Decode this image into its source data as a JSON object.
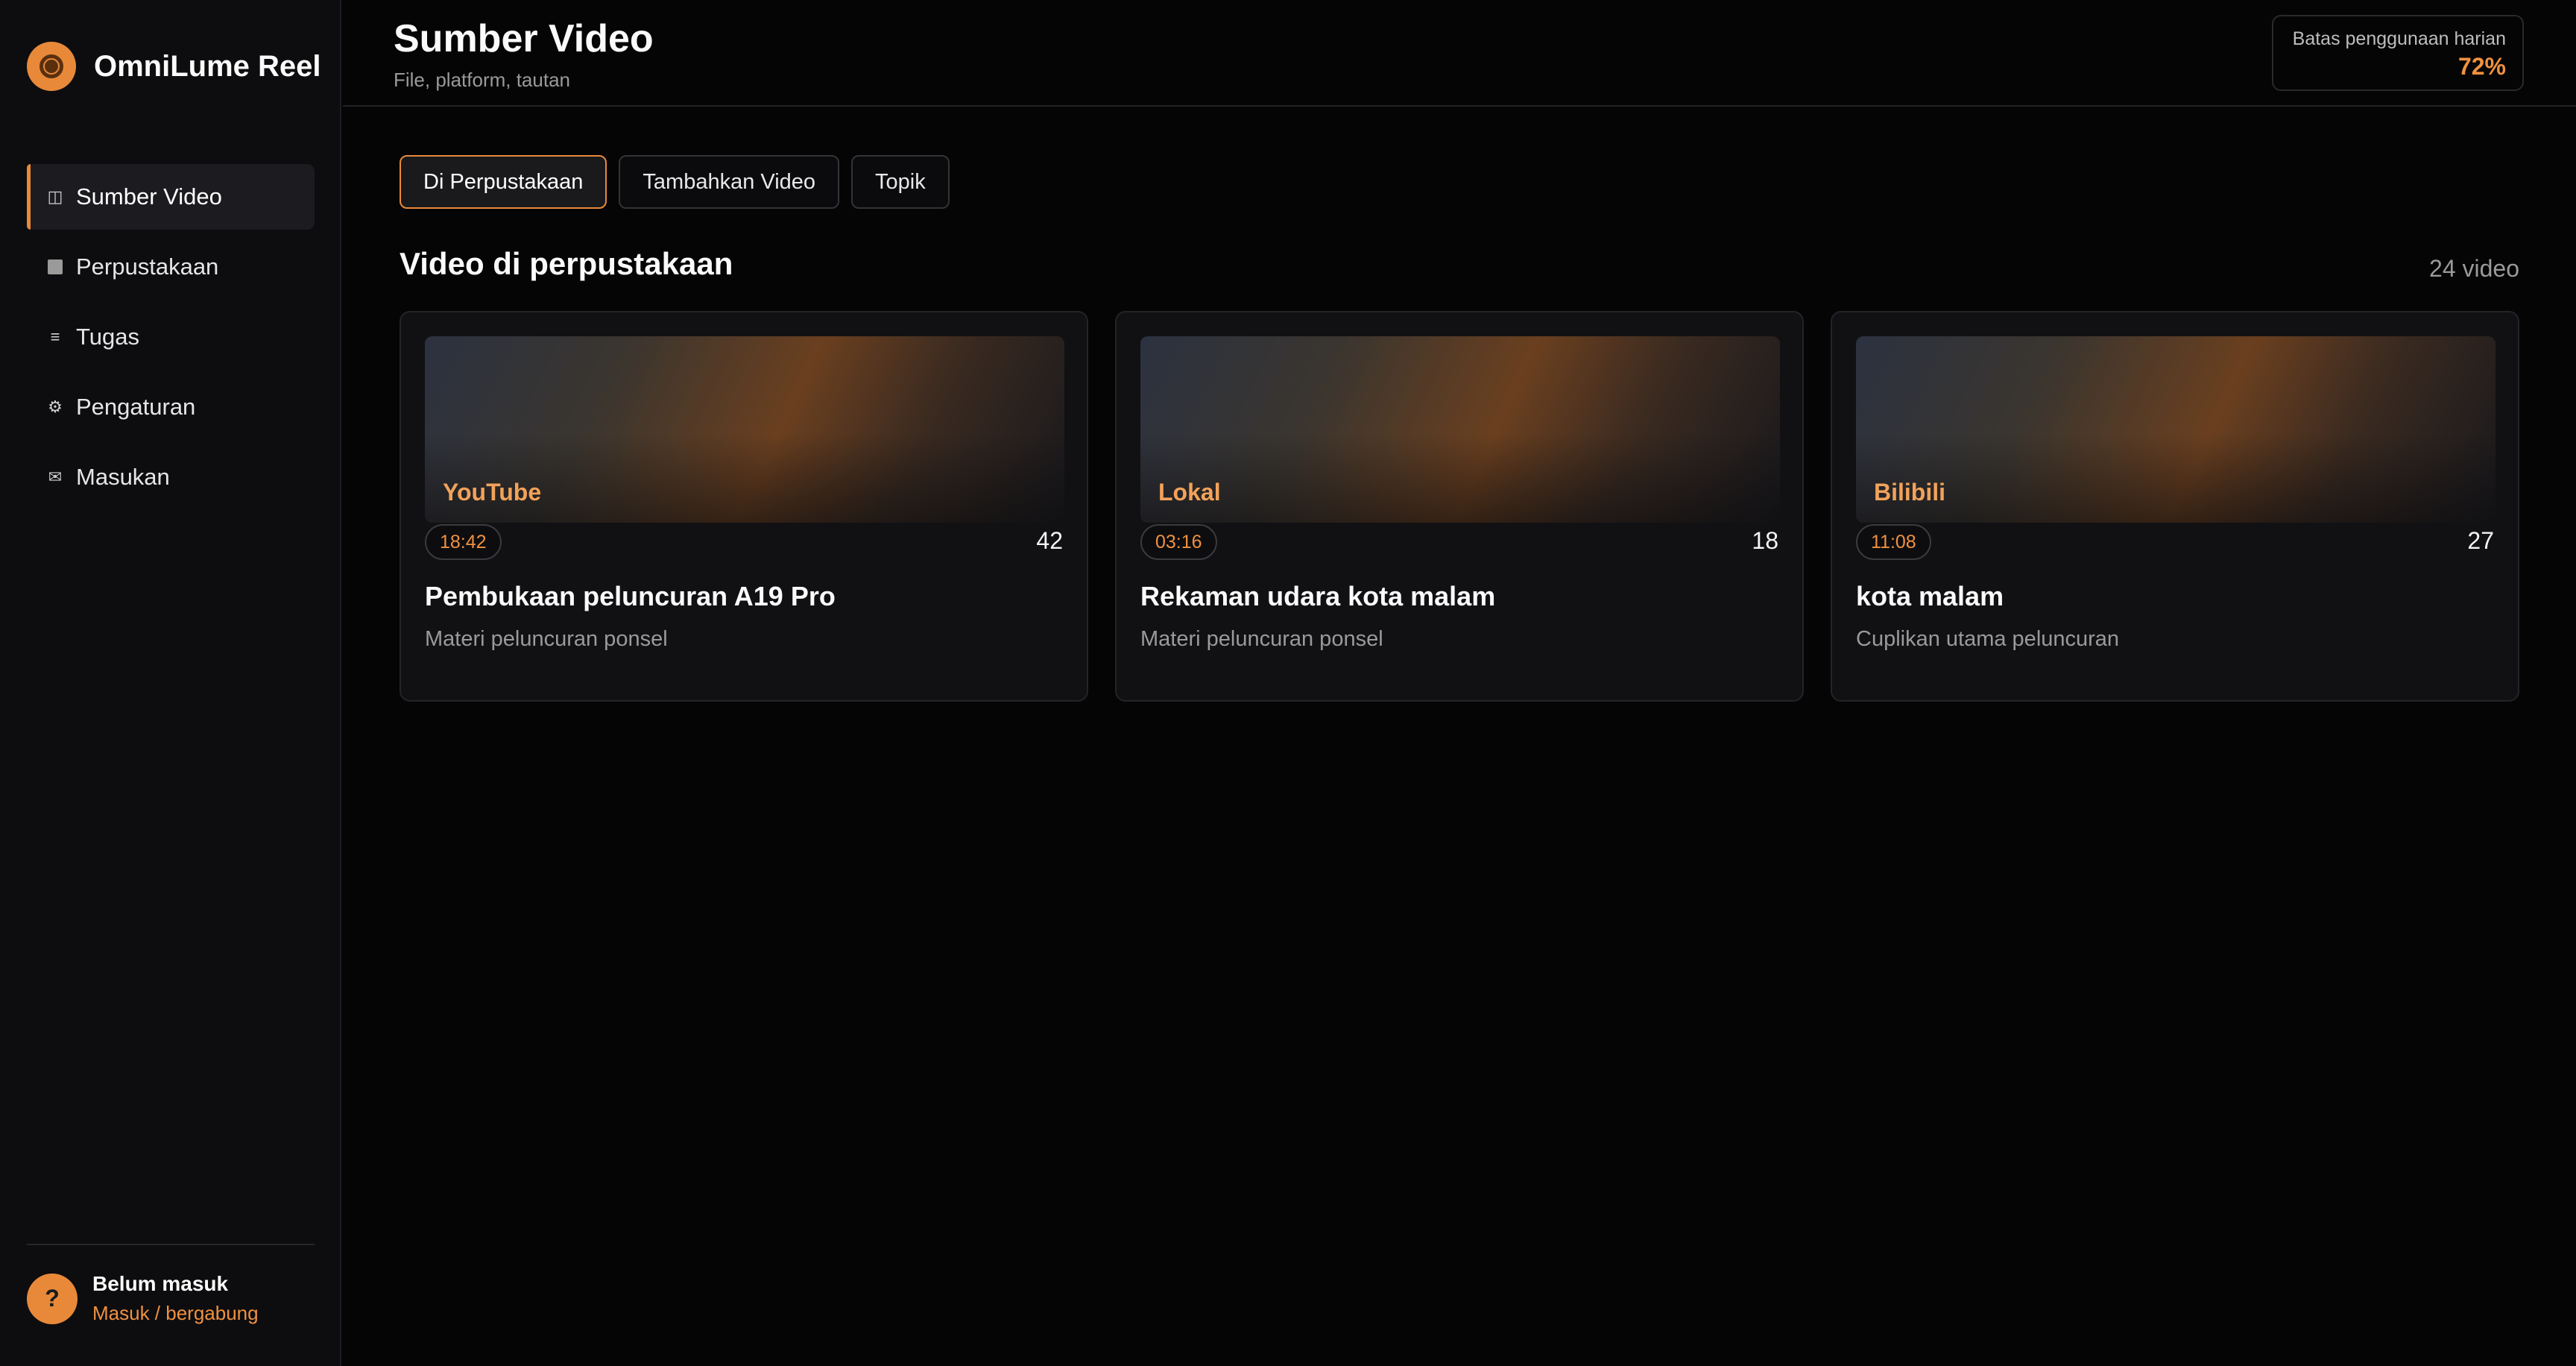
{
  "brand": {
    "name": "OmniLume Reel",
    "logo_icon": "camera-lens-icon",
    "accent": "#e8893a"
  },
  "sidebar": {
    "items": [
      {
        "label": "Sumber Video",
        "icon": "columns-icon",
        "glyph": "◫",
        "active": true
      },
      {
        "label": "Perpustakaan",
        "icon": "square-icon",
        "glyph": "",
        "active": false
      },
      {
        "label": "Tugas",
        "icon": "list-icon",
        "glyph": "≡",
        "active": false
      },
      {
        "label": "Pengaturan",
        "icon": "gear-icon",
        "glyph": "⚙",
        "active": false
      },
      {
        "label": "Masukan",
        "icon": "mail-icon",
        "glyph": "✉",
        "active": false
      }
    ]
  },
  "user": {
    "avatar": "?",
    "name": "Belum masuk",
    "link": "Masuk / bergabung"
  },
  "header": {
    "title": "Sumber Video",
    "subtitle": "File, platform, tautan",
    "usage": {
      "label": "Batas penggunaan harian",
      "value": "72%"
    }
  },
  "tabs": [
    {
      "label": "Di Perpustakaan",
      "active": true
    },
    {
      "label": "Tambahkan Video",
      "active": false
    },
    {
      "label": "Topik",
      "active": false
    }
  ],
  "section": {
    "title": "Video di perpustakaan",
    "count": "24 video"
  },
  "videos": [
    {
      "platform": "YouTube",
      "duration": "18:42",
      "count": "42",
      "title": "Pembukaan peluncuran A19 Pro",
      "desc": "Materi peluncuran ponsel"
    },
    {
      "platform": "Lokal",
      "duration": "03:16",
      "count": "18",
      "title": "Rekaman udara kota malam",
      "desc": "Materi peluncuran ponsel"
    },
    {
      "platform": "Bilibili",
      "duration": "11:08",
      "count": "27",
      "title": "kota malam",
      "desc": "Cuplikan utama peluncuran"
    }
  ]
}
